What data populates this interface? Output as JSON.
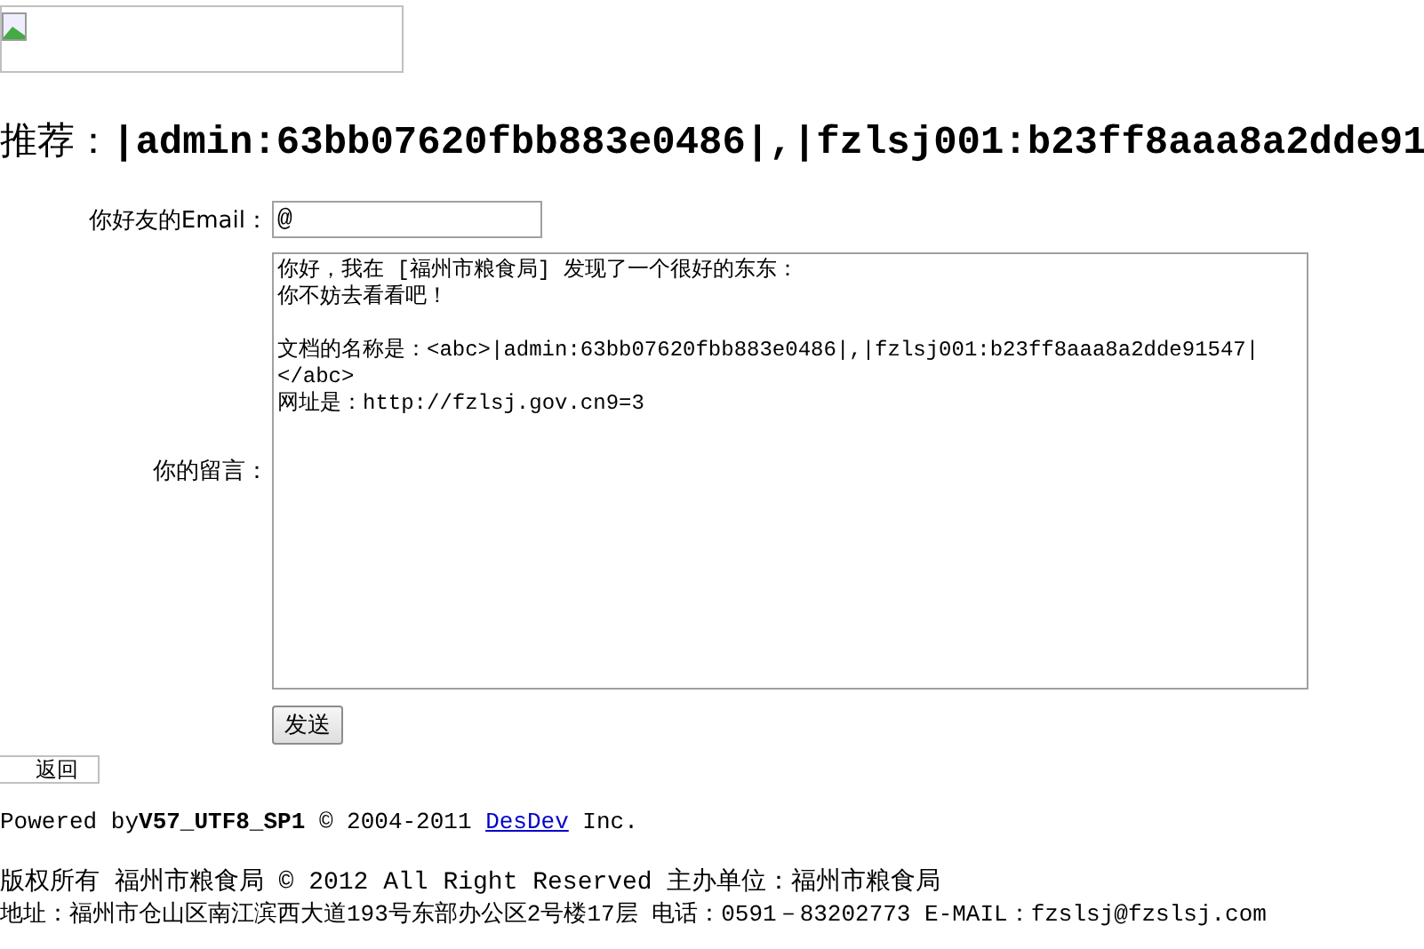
{
  "heading": {
    "label": "推荐：",
    "value": "|admin:63bb07620fbb883e0486|,|fzlsj001:b23ff8aaa8a2dde91"
  },
  "form": {
    "email_label": "你好友的Email：",
    "email_value": "@",
    "message_label": "你的留言：",
    "message_paragraphs": [
      [
        "你好，我在 [福州市粮食局] 发现了一个很好的东东：",
        "你不妨去看看吧！"
      ],
      [
        "文档的名称是：<abc>|admin:63bb07620fbb883e0486|,|fzlsj001:b23ff8aaa8a2dde91547|",
        "</abc>",
        "网址是：http://fzlsj.gov.cn9=3"
      ]
    ],
    "submit": "发送"
  },
  "back_link": "返回",
  "footer": {
    "powered": "Powered by**V57_UTF8_SP1** © 2004-2011 ",
    "company_link": "DesDev",
    "powered_end": " Inc.",
    "copyright": "版权所有 福州市粮食局 © 2012 All Right Reserved 主办单位：福州市粮食局",
    "address": "地址：福州市仓山区南江滨西大道193号东部办公区2号楼17层 电话：0591－83202773 E-MAIL：fzslsj@fzslsj.com"
  }
}
